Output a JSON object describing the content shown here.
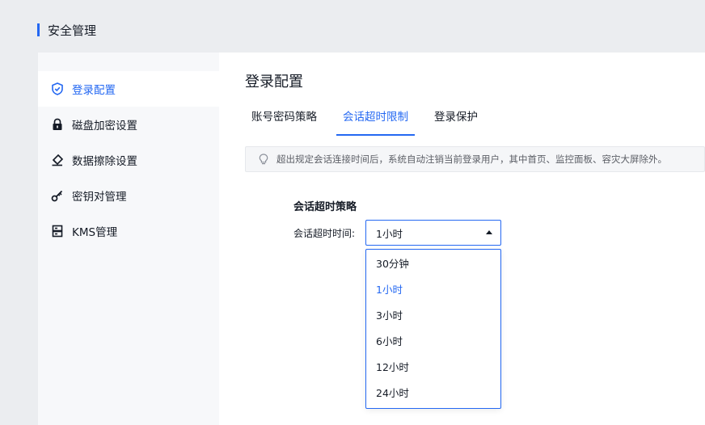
{
  "header": {
    "title": "安全管理",
    "accent": "#2468f2"
  },
  "sidebar": {
    "items": [
      {
        "label": "登录配置",
        "icon": "shield-check-icon",
        "active": true
      },
      {
        "label": "磁盘加密设置",
        "icon": "lock-icon",
        "active": false
      },
      {
        "label": "数据擦除设置",
        "icon": "eraser-icon",
        "active": false
      },
      {
        "label": "密钥对管理",
        "icon": "key-icon",
        "active": false
      },
      {
        "label": "KMS管理",
        "icon": "server-icon",
        "active": false
      }
    ]
  },
  "main": {
    "title": "登录配置",
    "tabs": [
      {
        "label": "账号密码策略",
        "active": false
      },
      {
        "label": "会话超时限制",
        "active": true
      },
      {
        "label": "登录保护",
        "active": false
      }
    ],
    "notice": {
      "icon": "lightbulb-icon",
      "text": "超出规定会话连接时间后，系统自动注销当前登录用户，其中首页、监控面板、容灾大屏除外。"
    },
    "section_title": "会话超时策略",
    "field": {
      "label": "会话超时时间:",
      "value": "1小时",
      "expanded": true,
      "options": [
        {
          "label": "30分钟",
          "selected": false
        },
        {
          "label": "1小时",
          "selected": true
        },
        {
          "label": "3小时",
          "selected": false
        },
        {
          "label": "6小时",
          "selected": false
        },
        {
          "label": "12小时",
          "selected": false
        },
        {
          "label": "24小时",
          "selected": false
        }
      ]
    }
  }
}
